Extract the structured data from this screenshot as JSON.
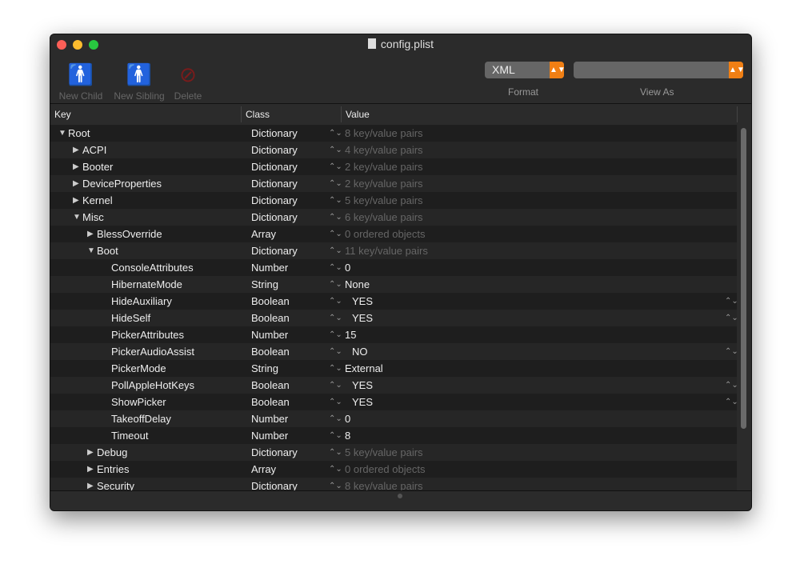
{
  "window": {
    "title": "config.plist"
  },
  "toolbar": {
    "new_child": "New Child",
    "new_sibling": "New Sibling",
    "delete": "Delete",
    "format_value": "XML",
    "format_label": "Format",
    "view_as_value": "",
    "view_as_label": "View As"
  },
  "colors": {
    "accent": "#f07f14"
  },
  "columns": {
    "key": "Key",
    "class": "Class",
    "value": "Value"
  },
  "rows": [
    {
      "key": "Root",
      "level": 0,
      "expand": "open",
      "class": "Dictionary",
      "value": "8 key/value pairs",
      "dim": true
    },
    {
      "key": "ACPI",
      "level": 1,
      "expand": "closed",
      "class": "Dictionary",
      "value": "4 key/value pairs",
      "dim": true
    },
    {
      "key": "Booter",
      "level": 1,
      "expand": "closed",
      "class": "Dictionary",
      "value": "2 key/value pairs",
      "dim": true
    },
    {
      "key": "DeviceProperties",
      "level": 1,
      "expand": "closed",
      "class": "Dictionary",
      "value": "2 key/value pairs",
      "dim": true
    },
    {
      "key": "Kernel",
      "level": 1,
      "expand": "closed",
      "class": "Dictionary",
      "value": "5 key/value pairs",
      "dim": true
    },
    {
      "key": "Misc",
      "level": 1,
      "expand": "open",
      "class": "Dictionary",
      "value": "6 key/value pairs",
      "dim": true
    },
    {
      "key": "BlessOverride",
      "level": 2,
      "expand": "closed",
      "class": "Array",
      "value": "0 ordered objects",
      "dim": true
    },
    {
      "key": "Boot",
      "level": 2,
      "expand": "open",
      "class": "Dictionary",
      "value": "11 key/value pairs",
      "dim": true
    },
    {
      "key": "ConsoleAttributes",
      "level": 3,
      "class": "Number",
      "value": "0"
    },
    {
      "key": "HibernateMode",
      "level": 3,
      "class": "String",
      "value": "None"
    },
    {
      "key": "HideAuxiliary",
      "level": 3,
      "class": "Boolean",
      "value": "YES",
      "bool": true
    },
    {
      "key": "HideSelf",
      "level": 3,
      "class": "Boolean",
      "value": "YES",
      "bool": true
    },
    {
      "key": "PickerAttributes",
      "level": 3,
      "class": "Number",
      "value": "15"
    },
    {
      "key": "PickerAudioAssist",
      "level": 3,
      "class": "Boolean",
      "value": "NO",
      "bool": true
    },
    {
      "key": "PickerMode",
      "level": 3,
      "class": "String",
      "value": "External"
    },
    {
      "key": "PollAppleHotKeys",
      "level": 3,
      "class": "Boolean",
      "value": "YES",
      "bool": true
    },
    {
      "key": "ShowPicker",
      "level": 3,
      "class": "Boolean",
      "value": "YES",
      "bool": true
    },
    {
      "key": "TakeoffDelay",
      "level": 3,
      "class": "Number",
      "value": "0"
    },
    {
      "key": "Timeout",
      "level": 3,
      "class": "Number",
      "value": "8"
    },
    {
      "key": "Debug",
      "level": 2,
      "expand": "closed",
      "class": "Dictionary",
      "value": "5 key/value pairs",
      "dim": true
    },
    {
      "key": "Entries",
      "level": 2,
      "expand": "closed",
      "class": "Array",
      "value": "0 ordered objects",
      "dim": true
    },
    {
      "key": "Security",
      "level": 2,
      "expand": "closed",
      "class": "Dictionary",
      "value": "8 key/value pairs",
      "dim": true
    }
  ]
}
